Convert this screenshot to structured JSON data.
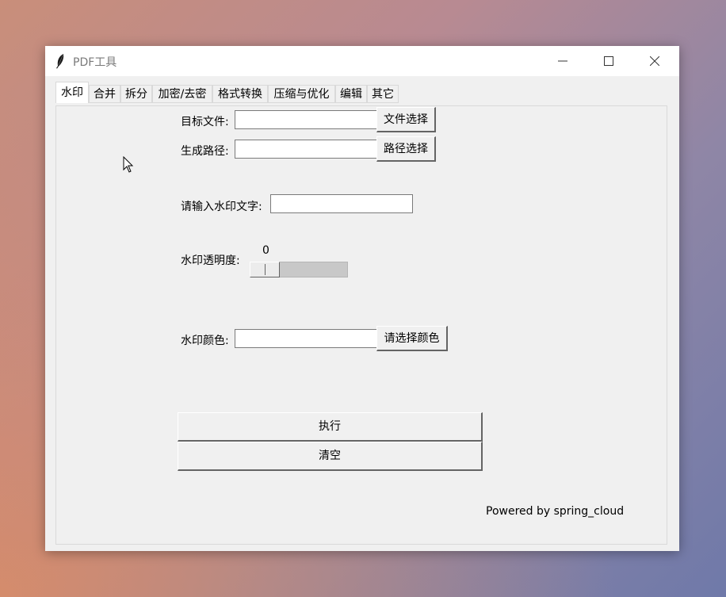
{
  "window": {
    "title": "PDF工具",
    "icon": "feather-icon",
    "controls": [
      "minimize-icon",
      "maximize-icon",
      "close-icon"
    ]
  },
  "tabs": [
    {
      "label": "水印",
      "active": true
    },
    {
      "label": "合并",
      "active": false
    },
    {
      "label": "拆分",
      "active": false
    },
    {
      "label": "加密/去密",
      "active": false
    },
    {
      "label": "格式转换",
      "active": false
    },
    {
      "label": "压缩与优化",
      "active": false
    },
    {
      "label": "编辑",
      "active": false
    },
    {
      "label": "其它",
      "active": false
    }
  ],
  "form": {
    "target_file": {
      "label": "目标文件:",
      "value": "",
      "button": "文件选择"
    },
    "output_path": {
      "label": "生成路径:",
      "value": "",
      "button": "路径选择"
    },
    "watermark_text": {
      "label": "请输入水印文字:",
      "value": ""
    },
    "opacity": {
      "label": "水印透明度:",
      "value": "0"
    },
    "color": {
      "label": "水印颜色:",
      "value": "",
      "button": "请选择颜色"
    }
  },
  "actions": {
    "execute": "执行",
    "clear": "清空"
  },
  "footer": "Powered by spring_cloud"
}
